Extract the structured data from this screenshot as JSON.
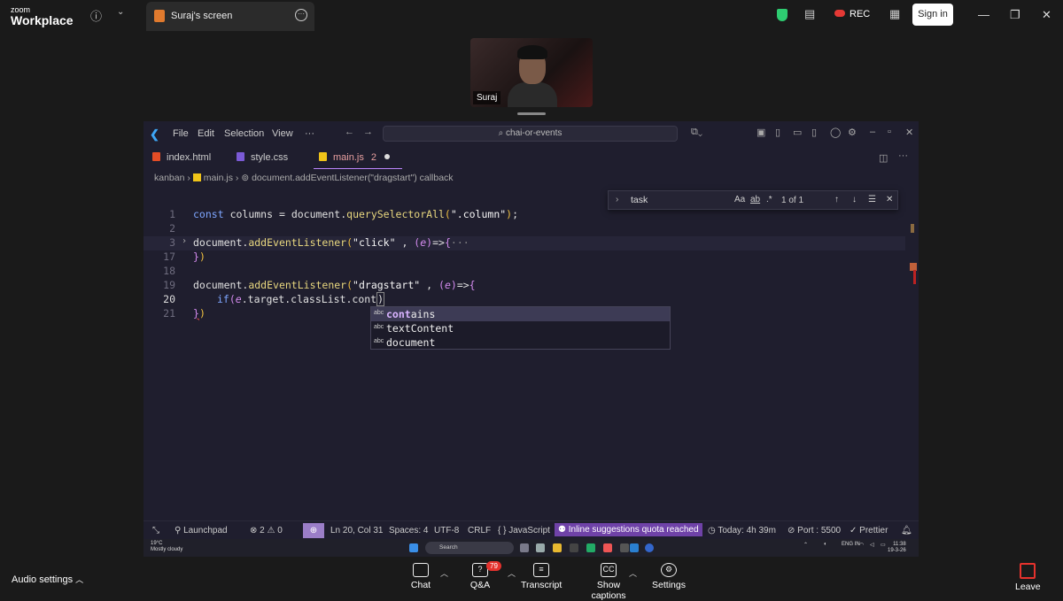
{
  "zoom": {
    "brand_line1": "zoom",
    "brand_line2": "Workplace",
    "share_tab_label": "Suraj's screen",
    "rec_label": "REC",
    "sign_in_label": "Sign in",
    "participant_name": "Suraj",
    "toolbar": {
      "audio_settings": "Audio settings",
      "chat": "Chat",
      "qa": "Q&A",
      "qa_badge": "79",
      "transcript": "Transcript",
      "captions": "Show captions",
      "settings": "Settings",
      "leave": "Leave"
    }
  },
  "vscode": {
    "menu": [
      "File",
      "Edit",
      "Selection",
      "View",
      "···"
    ],
    "command_center": "chai-or-events",
    "tabs": [
      {
        "name": "index.html",
        "color": "#e44d26"
      },
      {
        "name": "style.css",
        "color": "#7b5ad6"
      },
      {
        "name": "main.js",
        "color": "#f0c419",
        "problems": "2"
      }
    ],
    "breadcrumb": {
      "folder": "kanban",
      "file": "main.js",
      "symbol": "document.addEventListener(\"dragstart\") callback"
    },
    "find_widget": {
      "query": "task",
      "match_case": "Aa",
      "whole_word": "ab",
      "regex": ".*",
      "count": "1 of 1"
    },
    "lines": [
      {
        "num": "1"
      },
      {
        "num": "2"
      },
      {
        "num": "3"
      },
      {
        "num": "17"
      },
      {
        "num": "18"
      },
      {
        "num": "19"
      },
      {
        "num": "20"
      },
      {
        "num": "21"
      }
    ],
    "suggestions": [
      {
        "kind": "abc",
        "match": "cont",
        "rest": "ains"
      },
      {
        "kind": "abc",
        "match": "",
        "rest": "textContent"
      },
      {
        "kind": "abc",
        "match": "",
        "rest": "document"
      }
    ],
    "status": {
      "launchpad": "Launchpad",
      "problems": "⊗ 2 ⚠ 0",
      "position": "Ln 20, Col 31",
      "spaces": "Spaces: 4",
      "encoding": "UTF-8",
      "eol": "CRLF",
      "language": "{ } JavaScript",
      "quota": "Inline suggestions quota reached",
      "today": "Today: 4h 39m",
      "port": "Port : 5500",
      "prettier": "Prettier"
    }
  },
  "taskbar": {
    "weather_temp": "19°C",
    "weather_desc": "Mostly cloudy",
    "search": "Search",
    "lang": "ENG IN",
    "time": "11:38",
    "date": "19-3-26"
  }
}
